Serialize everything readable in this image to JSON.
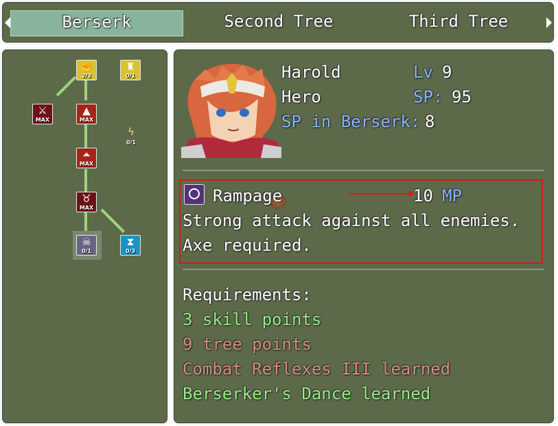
{
  "tabs": {
    "items": [
      {
        "label": "Berserk",
        "selected": true
      },
      {
        "label": "Second Tree",
        "selected": false
      },
      {
        "label": "Third Tree",
        "selected": false
      }
    ]
  },
  "tree": {
    "nodes": [
      {
        "icon": "fist-icon",
        "count": "2/3",
        "color": "#d8c230"
      },
      {
        "icon": "trophy-icon",
        "count": "0/1",
        "color": "#d8c230"
      },
      {
        "icon": "sword-strike-icon",
        "count": "MAX",
        "color": "#6b1219"
      },
      {
        "icon": "single-chevron-up-icon",
        "count": "MAX",
        "color": "#a62419"
      },
      {
        "icon": "lightning-icon",
        "count": "0/1",
        "color": "none"
      },
      {
        "icon": "double-chevron-up-icon",
        "count": "MAX",
        "color": "#a62419"
      },
      {
        "icon": "horned-helmet-icon",
        "count": "MAX",
        "color": "#6b1219"
      },
      {
        "icon": "skull-icon",
        "count": "0/1",
        "color": "#6a6480"
      },
      {
        "icon": "hourglass-icon",
        "count": "0/3",
        "color": "#1b93c2"
      }
    ]
  },
  "actor": {
    "name": "Harold",
    "class": "Hero",
    "level_label": "Lv",
    "level": "9",
    "sp_label": "SP:",
    "sp": "95",
    "tree_sp_label": "SP in Berserk:",
    "tree_sp": "8"
  },
  "skill": {
    "name": "Rampage",
    "cost": "10",
    "cost_unit": "MP",
    "description_1": "Strong attack against all enemies.",
    "description_2": "Axe required."
  },
  "requirements": {
    "title": "Requirements:",
    "items": [
      {
        "text": "3 skill points",
        "met": true
      },
      {
        "text": "9 tree points",
        "met": false
      },
      {
        "text": "Combat Reflexes III learned",
        "met": false
      },
      {
        "text": "Berserker's Dance learned",
        "met": true
      }
    ]
  },
  "colors": {
    "window_bg": "#5d6a4a",
    "system_text": "#86b6ff",
    "met": "#98ee88",
    "unmet": "#d48f84",
    "highlight_box": "#d81818"
  }
}
